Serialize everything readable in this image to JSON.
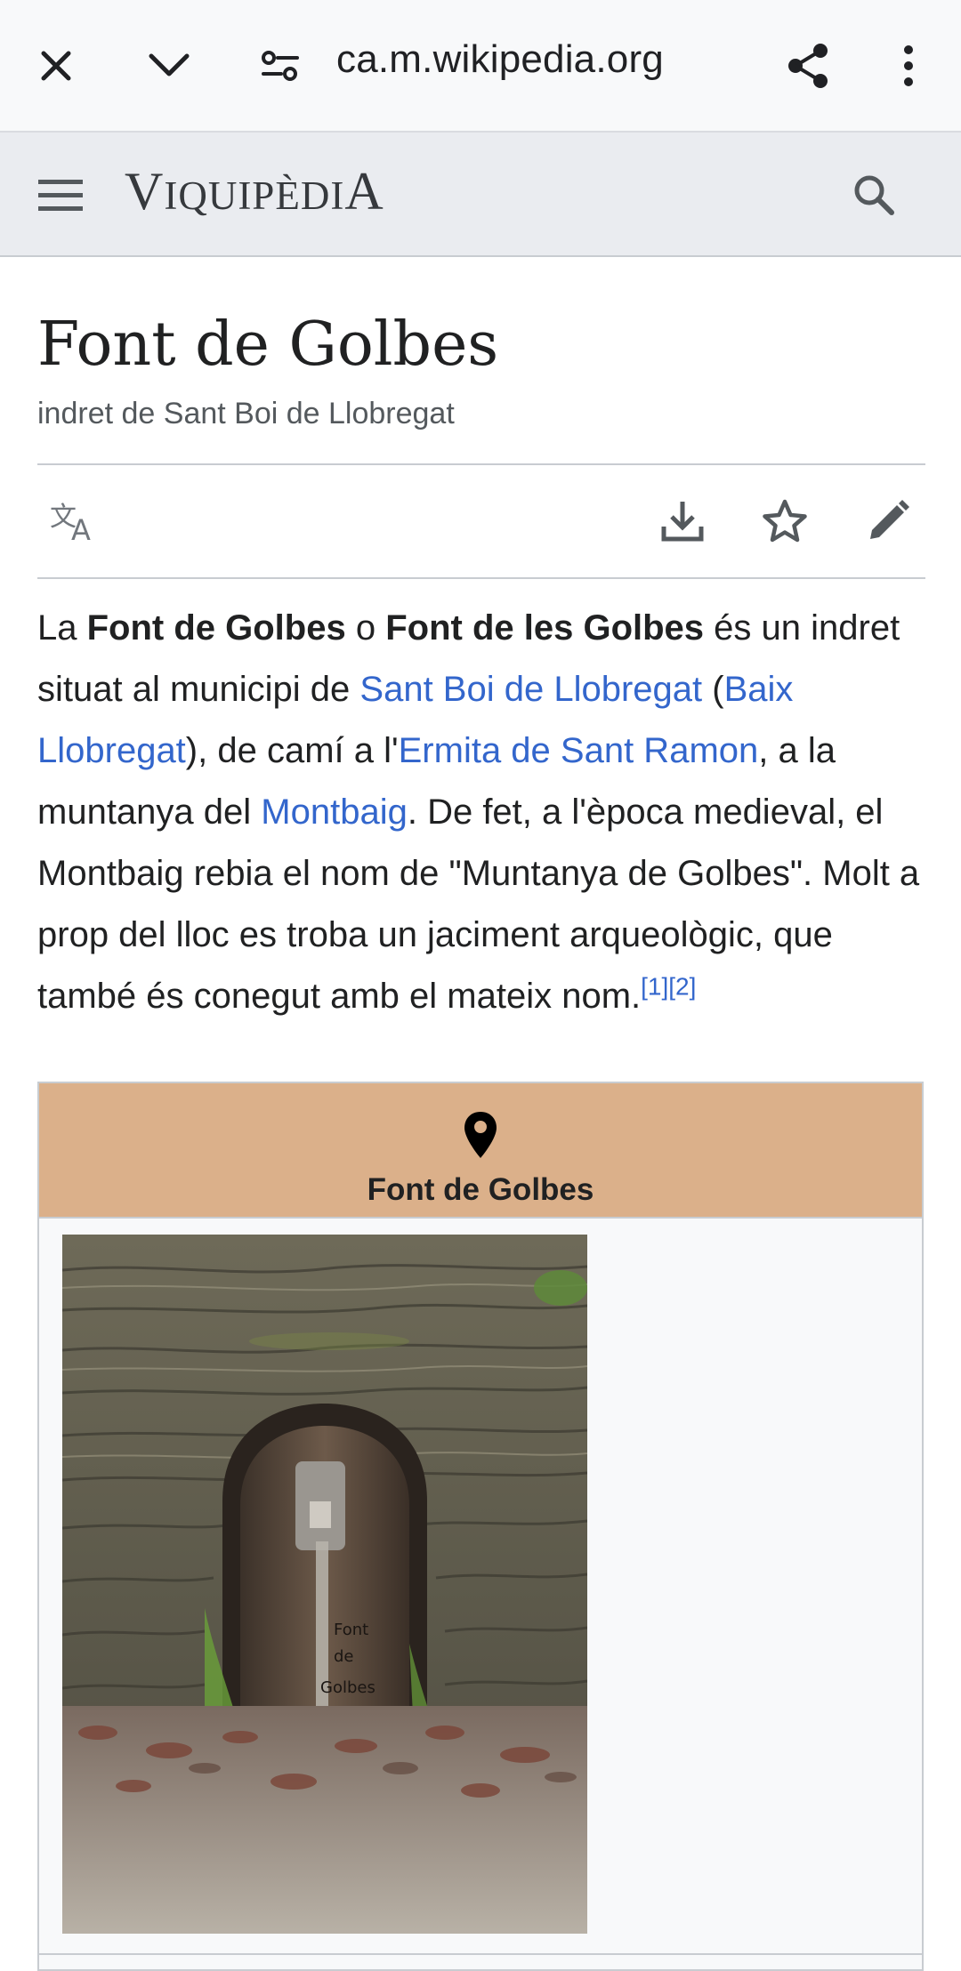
{
  "browser": {
    "url": "ca.m.wikipedia.org"
  },
  "wiki": {
    "wordmark": {
      "v": "V",
      "iquip": "IQUIPÈDI",
      "a": "A"
    }
  },
  "article": {
    "title": "Font de Golbes",
    "subtitle": "indret de Sant Boi de Llobregat",
    "intro": {
      "t1": "La ",
      "b1": "Font de Golbes",
      "t2": " o ",
      "b2": "Font de les Golbes",
      "t3": " és un indret situat al municipi de ",
      "l1": "Sant Boi de Llobregat",
      "t4": " (",
      "l2": "Baix Llobregat",
      "t5": "), de camí a l'",
      "l3": "Ermita de Sant Ramon",
      "t6": ", a la muntanya del ",
      "l4": "Montbaig",
      "t7": ". De fet, a l'època medieval, el Montbaig rebia el nom de \"Muntanya de Golbes\". Molt a prop del lloc es troba un jaciment arqueològic, que també és conegut amb el mateix nom.",
      "ref1": "[1]",
      "ref2": "[2]"
    }
  },
  "infobox": {
    "title": "Font de Golbes",
    "header_color": "#dbb08a"
  },
  "colors": {
    "link": "#3366cc",
    "text": "#202122"
  }
}
